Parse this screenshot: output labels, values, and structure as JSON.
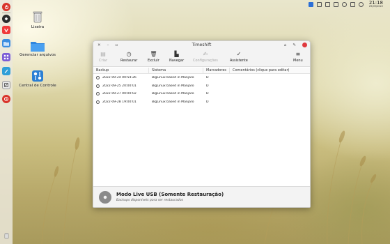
{
  "tray": {
    "time": "21:18",
    "date": "29/09/2022"
  },
  "desktop": {
    "items": [
      {
        "label": "Lixeira",
        "icon": "trash-icon"
      },
      {
        "label": "Gerenciar arquivos",
        "icon": "folder-icon"
      },
      {
        "label": "Central de Controle",
        "icon": "control-center-icon"
      }
    ]
  },
  "dock": {
    "items": [
      "biglinux-menu-icon",
      "vivaldi-browser-icon",
      "files-icon",
      "apps-grid-icon",
      "text-editor-icon",
      "system-settings-icon",
      "timeshift-icon"
    ],
    "bottom_item": "trash-icon"
  },
  "window": {
    "title": "Timeshift",
    "controls": [
      "close-icon",
      "minimize-icon",
      "maximize-icon"
    ],
    "right_controls": [
      "restore-icon",
      "pin-icon",
      "close-icon"
    ]
  },
  "toolbar": {
    "items": [
      {
        "label": "Criar",
        "icon": "create-icon",
        "enabled": false
      },
      {
        "label": "Restaurar",
        "icon": "restore-icon",
        "enabled": true
      },
      {
        "label": "Excluir",
        "icon": "delete-icon",
        "enabled": true
      },
      {
        "label": "Navegar",
        "icon": "browse-icon",
        "enabled": true
      },
      {
        "label": "Configurações",
        "icon": "settings-icon",
        "enabled": false
      },
      {
        "label": "Assistente",
        "icon": "wizard-icon",
        "enabled": true
      },
      {
        "label": "Menu",
        "icon": "menu-icon",
        "enabled": true
      }
    ]
  },
  "table": {
    "headers": [
      "Backup",
      "Sistema",
      "Marcadores",
      "Comentários (clique para editar)"
    ],
    "rows": [
      {
        "backup": "2022-09-24 00:54:26",
        "system": "BigLinux based in Manjaro",
        "tags": "D",
        "comment": ""
      },
      {
        "backup": "2022-09-25 20:00:01",
        "system": "BigLinux based in Manjaro",
        "tags": "D",
        "comment": ""
      },
      {
        "backup": "2022-09-27 00:00:02",
        "system": "BigLinux based in Manjaro",
        "tags": "D",
        "comment": ""
      },
      {
        "backup": "2022-09-28 19:00:01",
        "system": "BigLinux based in Manjaro",
        "tags": "D",
        "comment": ""
      }
    ]
  },
  "footer": {
    "title": "Modo Live USB (Somente Restauração)",
    "subtitle": "Backups disponíveis para ser restaurados"
  },
  "colors": {
    "accent_red": "#e0393e",
    "accent_blue": "#2c6fd6"
  }
}
